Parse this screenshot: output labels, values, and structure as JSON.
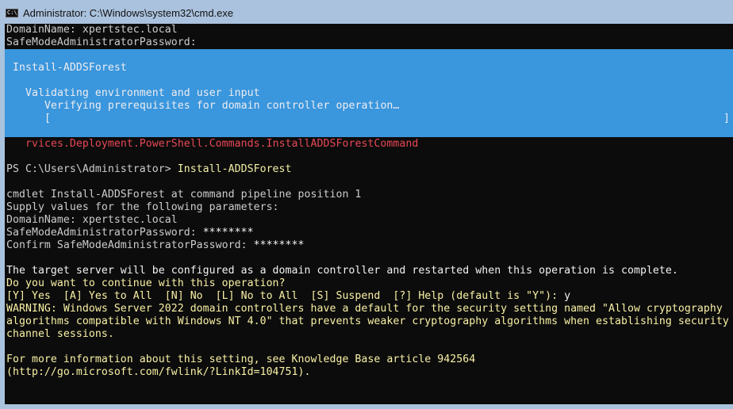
{
  "window": {
    "title": "Administrator: C:\\Windows\\system32\\cmd.exe",
    "icon": "cmd-icon",
    "icon_text": "C:\\_"
  },
  "console": {
    "top_lines": [
      "DomainName: xpertstec.local",
      "SafeModeAdministratorPassword:"
    ],
    "progress": {
      "activity": "Install-ADDSForest",
      "status": "Validating environment and user input",
      "operation": "Verifying prerequisites for domain controller operation…",
      "bar_left": "[",
      "bar_right": "]",
      "percent_complete": 0
    },
    "error_line": "rvices.Deployment.PowerShell.Commands.InstallADDSForestCommand",
    "prompt": "PS C:\\Users\\Administrator> ",
    "command": "Install-ADDSForest",
    "param_lines": [
      "cmdlet Install-ADDSForest at command pipeline position 1",
      "Supply values for the following parameters:",
      "DomainName: xpertstec.local",
      "SafeModeAdministratorPassword: ",
      "Confirm SafeModeAdministratorPassword: "
    ],
    "password_mask": "********",
    "confirm_mask": "********",
    "confirm_lines": [
      "The target server will be configured as a domain controller and restarted when this operation is complete.",
      "Do you want to continue with this operation?"
    ],
    "choice_prompt": "[Y] Yes  [A] Yes to All  [N] No  [L] No to All  [S] Suspend  [?] Help (default is \"Y\"): ",
    "choice_answer": "y",
    "warning_lines": [
      "WARNING: Windows Server 2022 domain controllers have a default for the security setting named \"Allow cryptography",
      "algorithms compatible with Windows NT 4.0\" that prevents weaker cryptography algorithms when establishing security",
      "channel sessions."
    ],
    "info_lines": [
      "For more information about this setting, see Knowledge Base article 942564",
      "(http://go.microsoft.com/fwlink/?LinkId=104751)."
    ],
    "colors": {
      "background": "#0c0c0c",
      "progress_background": "#3a96dd",
      "default_text": "#cccccc",
      "warning_text": "#f9f1a5",
      "error_text": "#e74856"
    }
  }
}
